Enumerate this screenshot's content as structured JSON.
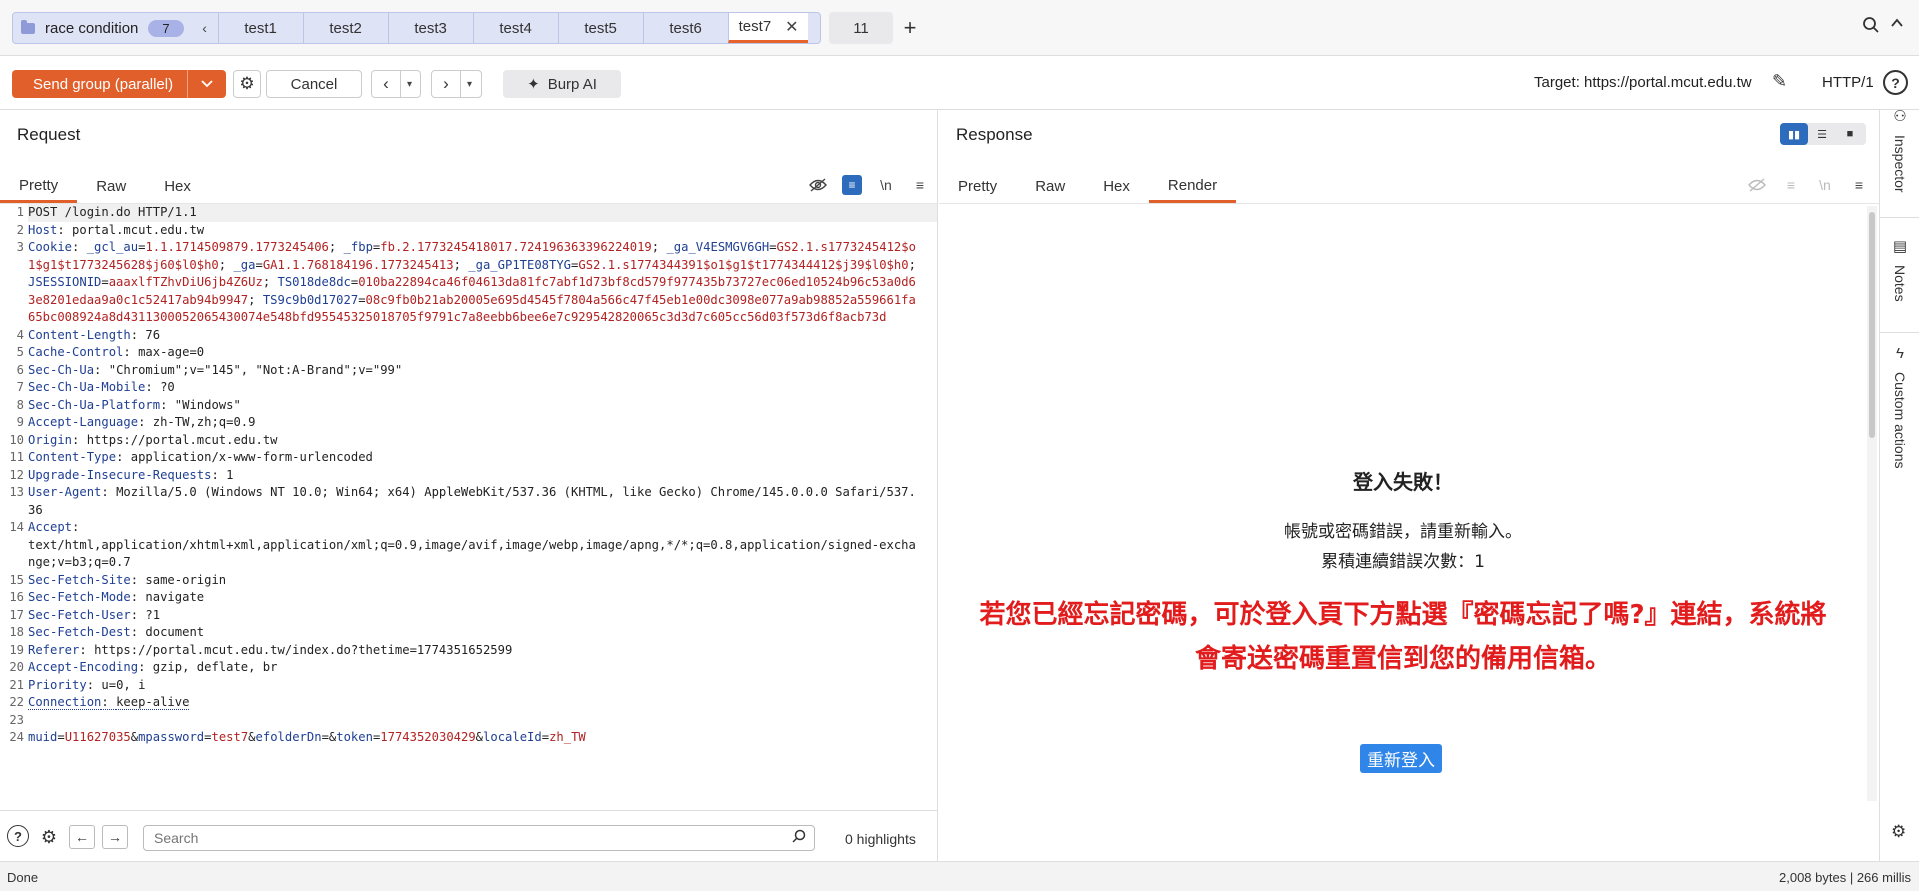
{
  "tabs": {
    "group_name": "race condition",
    "group_count": "7",
    "group_chevron": "‹",
    "subtabs": [
      "test1",
      "test2",
      "test3",
      "test4",
      "test5",
      "test6"
    ],
    "active_tab": "test7",
    "close_glyph": "✕",
    "other_tab": "11",
    "add_glyph": "+"
  },
  "toolbar": {
    "send_label": "Send group (parallel)",
    "cancel_label": "Cancel",
    "burp_ai_label": "Burp AI",
    "target_label": "Target: https://portal.mcut.edu.tw",
    "protocol": "HTTP/1",
    "help_glyph": "?"
  },
  "request": {
    "title": "Request",
    "view_tabs": [
      "Pretty",
      "Raw",
      "Hex"
    ],
    "newline_toggle": "\\n",
    "lines": {
      "l1": "POST /login.do HTTP/1.1",
      "l2k": "Host",
      "l2v": "portal.mcut.edu.tw",
      "l3k": "Cookie",
      "c1n": "_gcl_au",
      "c1v": "1.1.1714509879.1773245406",
      "c2n": "_fbp",
      "c2v": "fb.2.1773245418017.724196363396224019",
      "c3n": "_ga_V4ESMGV6GH",
      "c3v": "GS2.1.s1773245412$o1$g1$t1773245628$j60$l0$h0",
      "c4n": "_ga",
      "c4v": "GA1.1.768184196.1773245413",
      "c5n": "_ga_GP1TE08TYG",
      "c5v": "GS2.1.s1774344391$o1$g1$t1774344412$j39$l0$h0",
      "c6n": "JSESSIONID",
      "c6v": "aaaxlfTZhvDiU6jb4Z6Uz",
      "c7n": "TS018de8dc",
      "c7v": "010ba22894ca46f04613da81fc7abf1d73bf8cd579f977435b73727ec06ed10524b96c53a0d63e8201edaa9a0c1c52417ab94b9947",
      "c8n": "TS9c9b0d17027",
      "c8v": "08c9fb0b21ab20005e695d4545f7804a566c47f45eb1e00dc3098e077a9ab98852a559661fa65bc008924a8d4311300052065430074e548bfd95545325018705f9791c7a8eebb6bee6e7c929542820065c3d3d7c605cc56d03f573d6f8acb73d",
      "l4k": "Content-Length",
      "l4v": "76",
      "l5k": "Cache-Control",
      "l5v": "max-age=0",
      "l6k": "Sec-Ch-Ua",
      "l6v": "\"Chromium\";v=\"145\", \"Not:A-Brand\";v=\"99\"",
      "l7k": "Sec-Ch-Ua-Mobile",
      "l7v": "?0",
      "l8k": "Sec-Ch-Ua-Platform",
      "l8v": "\"Windows\"",
      "l9k": "Accept-Language",
      "l9v": "zh-TW,zh;q=0.9",
      "l10k": "Origin",
      "l10v": "https://portal.mcut.edu.tw",
      "l11k": "Content-Type",
      "l11v": "application/x-www-form-urlencoded",
      "l12k": "Upgrade-Insecure-Requests",
      "l12v": "1",
      "l13k": "User-Agent",
      "l13v": "Mozilla/5.0 (Windows NT 10.0; Win64; x64) AppleWebKit/537.36 (KHTML, like Gecko) Chrome/145.0.0.0 Safari/537.36",
      "l14k": "Accept",
      "l14v": "text/html,application/xhtml+xml,application/xml;q=0.9,image/avif,image/webp,image/apng,*/*;q=0.8,application/signed-exchange;v=b3;q=0.7",
      "l15k": "Sec-Fetch-Site",
      "l15v": "same-origin",
      "l16k": "Sec-Fetch-Mode",
      "l16v": "navigate",
      "l17k": "Sec-Fetch-User",
      "l17v": "?1",
      "l18k": "Sec-Fetch-Dest",
      "l18v": "document",
      "l19k": "Referer",
      "l19v": "https://portal.mcut.edu.tw/index.do?thetime=1774351652599",
      "l20k": "Accept-Encoding",
      "l20v": "gzip, deflate, br",
      "l21k": "Priority",
      "l21v": "u=0, i",
      "l22k": "Connection",
      "l22v": "keep-alive",
      "b1n": "muid",
      "b1v": "U11627035",
      "b2n": "mpassword",
      "b2v": "test7",
      "b3n": "efolderDn",
      "b3v": "",
      "b4n": "token",
      "b4v": "1774352030429",
      "b5n": "localeId",
      "b5v": "zh_TW"
    },
    "search_placeholder": "Search",
    "highlights": "0 highlights"
  },
  "response": {
    "title": "Response",
    "view_tabs": [
      "Pretty",
      "Raw",
      "Hex",
      "Render"
    ],
    "newline_toggle": "\\n",
    "render": {
      "title": "登入失敗！",
      "message1": "帳號或密碼錯誤，請重新輸入。",
      "message2": "累積連續錯誤次數：1",
      "warning_line1": "若您已經忘記密碼，可於登入頁下方點選『密碼忘記了嗎?』連結，系統將",
      "warning_line2": "會寄送密碼重置信到您的備用信箱。",
      "relogin_button": "重新登入"
    }
  },
  "side_rail": {
    "items": [
      "Inspector",
      "Notes",
      "Custom actions"
    ]
  },
  "status": {
    "left": "Done",
    "right": "2,008 bytes | 266 millis"
  },
  "colors": {
    "accent_orange": "#e05f2b",
    "selected_blue": "#2d6bbd",
    "warning_red": "#e21c1c",
    "relogin_blue": "#2f86e8"
  },
  "icons": {
    "group": "folder-icon",
    "search": "search-icon",
    "settings": "gear-icon",
    "edit_target": "pencil-icon",
    "help": "help-icon",
    "burp_ai": "sparkle-icon"
  }
}
